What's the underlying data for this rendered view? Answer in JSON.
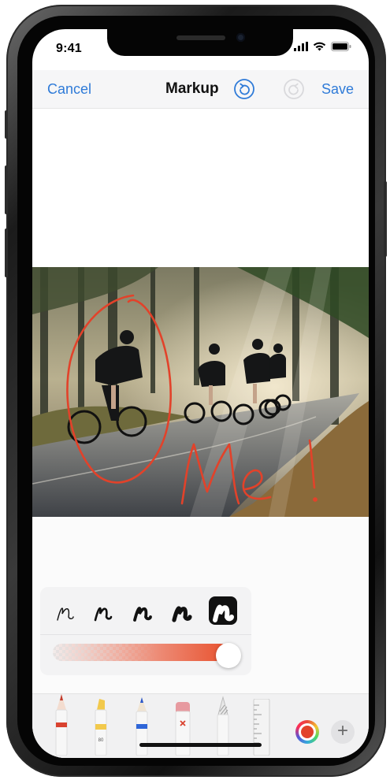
{
  "status_bar": {
    "time": "9:41"
  },
  "nav": {
    "cancel_label": "Cancel",
    "title": "Markup",
    "save_label": "Save",
    "undo_icon": "undo-icon",
    "redo_icon": "redo-icon"
  },
  "photo": {
    "subject": "cyclists-on-road",
    "handwriting": "Me!"
  },
  "stroke_widths": [
    "width-1",
    "width-2",
    "width-3",
    "width-4",
    "width-5"
  ],
  "selected_stroke_index": 4,
  "opacity_level": 0.9,
  "tools": [
    "pen",
    "marker",
    "pencil",
    "eraser",
    "lasso",
    "ruler"
  ],
  "tool_labels": {
    "marker_number": "80"
  },
  "colors": {
    "accent": "#2f7bd8",
    "ink": "#e2422a"
  }
}
